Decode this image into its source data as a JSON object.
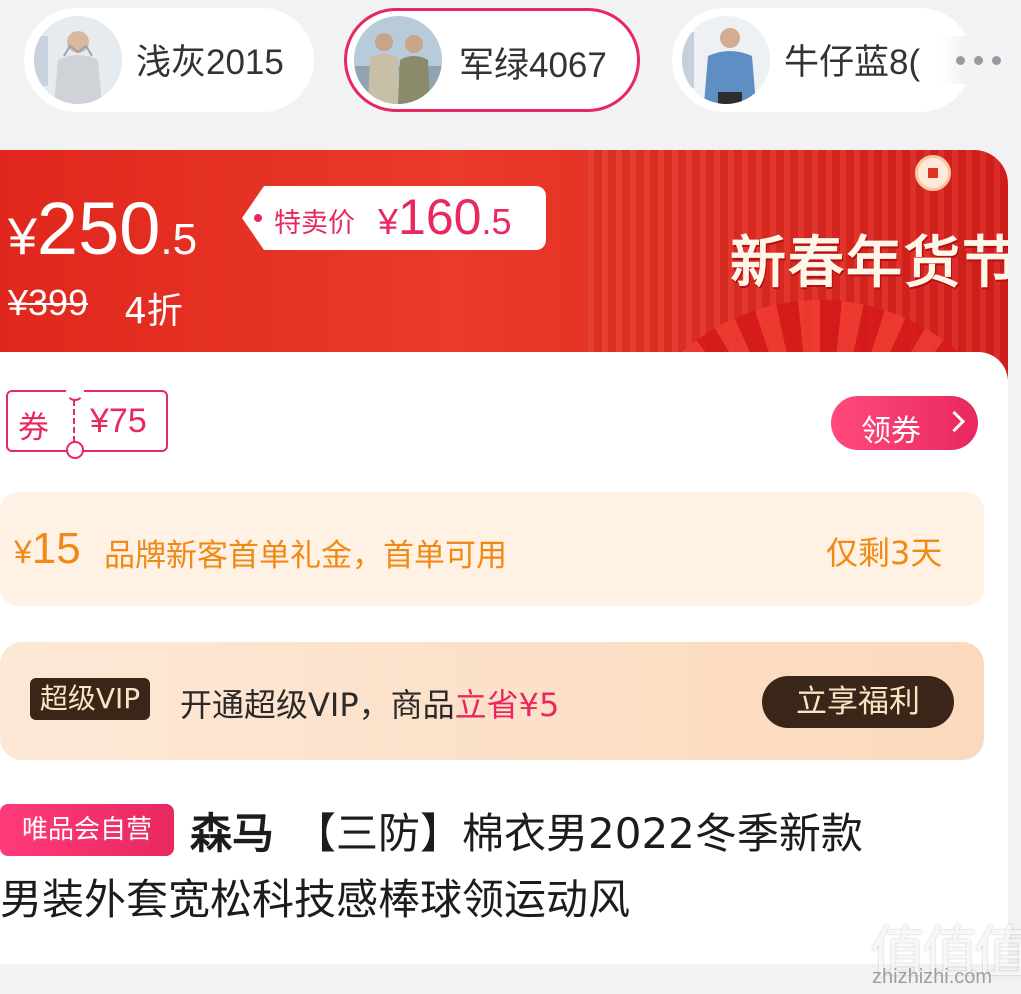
{
  "variants": [
    {
      "label": "浅灰2015",
      "selected": false
    },
    {
      "label": "军绿4067",
      "selected": true
    },
    {
      "label": "牛仔蓝8(",
      "selected": false
    }
  ],
  "more_icon": "ellipsis-icon",
  "banner": {
    "price_currency": "¥",
    "price_integer": "250",
    "price_decimal": ".5",
    "sale_label": "特卖价",
    "sale_currency": "¥",
    "sale_integer": "160",
    "sale_decimal": ".5",
    "original_price": "¥399",
    "discount": "4折",
    "festival": "新春年货节"
  },
  "coupon": {
    "label": "券",
    "value": "¥75",
    "button": "领券"
  },
  "gift": {
    "currency": "¥",
    "amount": "15",
    "description": "品牌新客首单礼金，首单可用",
    "remaining": "仅剩3天"
  },
  "vip": {
    "badge": "超级VIP",
    "text_prefix": "开通超级VIP，商品",
    "text_highlight": "立省¥5",
    "button": "立享福利"
  },
  "product": {
    "badge": "唯品会自营",
    "brand": "森马",
    "title_line1": "【三防】棉衣男2022冬季新款",
    "title_line2": "男装外套宽松科技感棒球领运动风"
  },
  "watermark": {
    "logo": "值值值",
    "url": "zhizhizhi.com"
  },
  "colors": {
    "accent": "#e8285f",
    "banner_red": "#e0271d",
    "gift_orange": "#f08a17",
    "vip_dark": "#3a2519"
  }
}
